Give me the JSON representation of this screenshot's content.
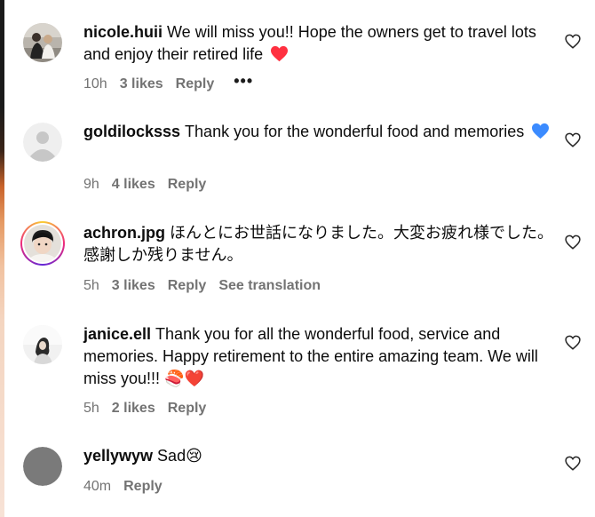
{
  "comments": [
    {
      "username": "nicole.huii",
      "text": "We will miss you!! Hope the owners get to travel lots and enjoy their retired life",
      "emoji": "❤️",
      "time": "10h",
      "likes": "3 likes",
      "reply": "Reply",
      "more": "•••"
    },
    {
      "username": "goldilocksss",
      "text": "Thank you for the wonderful food and memories",
      "emoji": "💙",
      "time": "9h",
      "likes": "4 likes",
      "reply": "Reply"
    },
    {
      "username": "achron.jpg",
      "text": "ほんとにお世話になりました。大変お疲れ様でした。感謝しか残りません。",
      "time": "5h",
      "likes": "3 likes",
      "reply": "Reply",
      "translation": "See translation"
    },
    {
      "username": "janice.ell",
      "text": "Thank you for all the wonderful food, service and memories. Happy retirement to the entire amazing team. We will miss you!!!",
      "emoji": "🍣❤️",
      "time": "5h",
      "likes": "2 likes",
      "reply": "Reply"
    },
    {
      "username": "yellywyw",
      "text": "Sad",
      "emoji": "😢",
      "time": "40m",
      "reply": "Reply"
    }
  ],
  "colors": {
    "meta": "#737373",
    "heart_red": "#ff3040",
    "heart_blue": "#3b8bff",
    "story_ring": "#ee2a7b"
  },
  "icons": {
    "like": "heart-outline-icon",
    "more": "more-options-icon"
  }
}
